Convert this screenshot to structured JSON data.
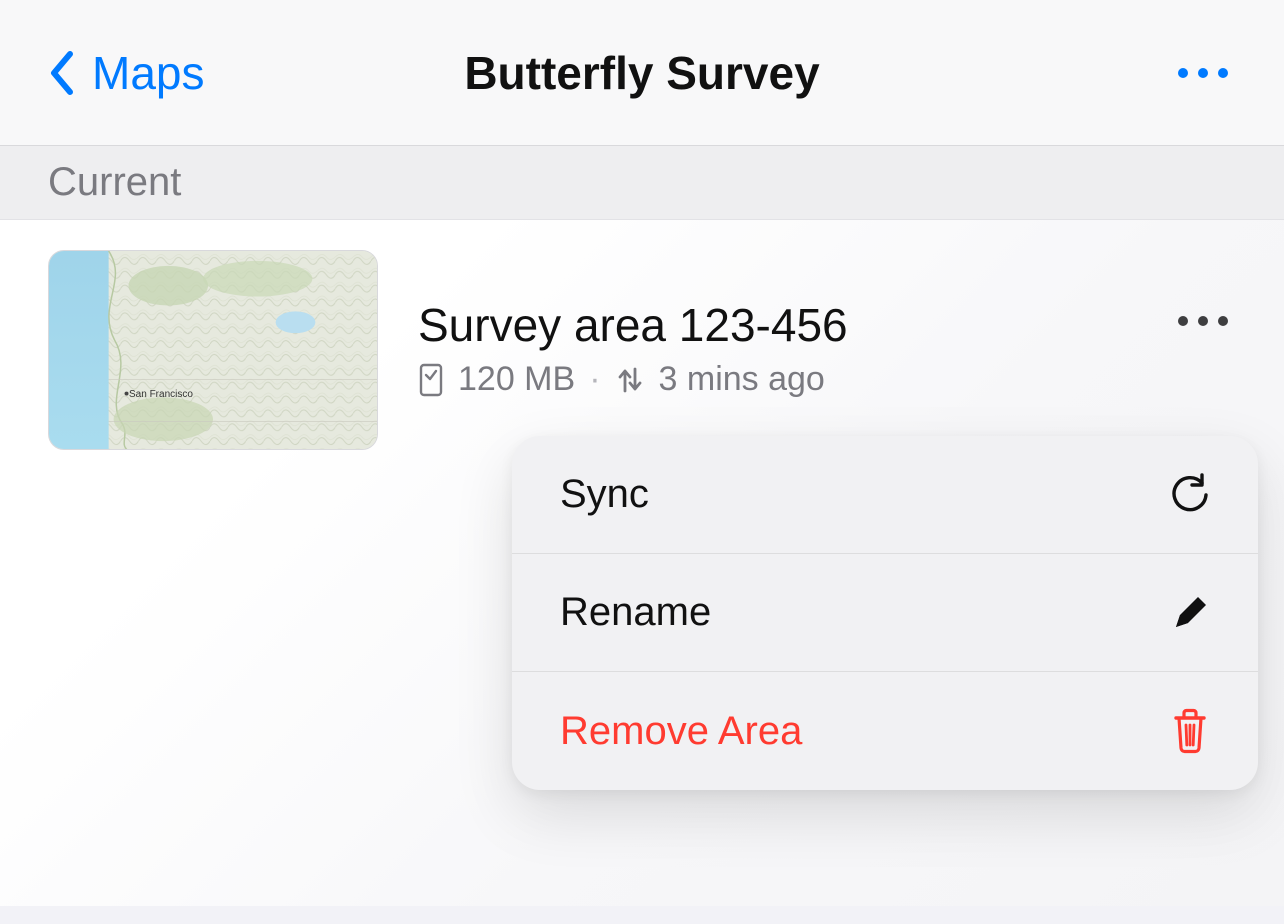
{
  "header": {
    "back_label": "Maps",
    "title": "Butterfly Survey"
  },
  "section": {
    "label": "Current"
  },
  "area": {
    "title": "Survey area 123-456",
    "size": "120 MB",
    "sync_time": "3 mins ago",
    "map_city_label": "San Francisco"
  },
  "menu": {
    "sync": "Sync",
    "rename": "Rename",
    "remove": "Remove Area"
  },
  "colors": {
    "accent": "#007aff",
    "danger": "#ff3b30",
    "text_secondary": "#7a7a80"
  }
}
